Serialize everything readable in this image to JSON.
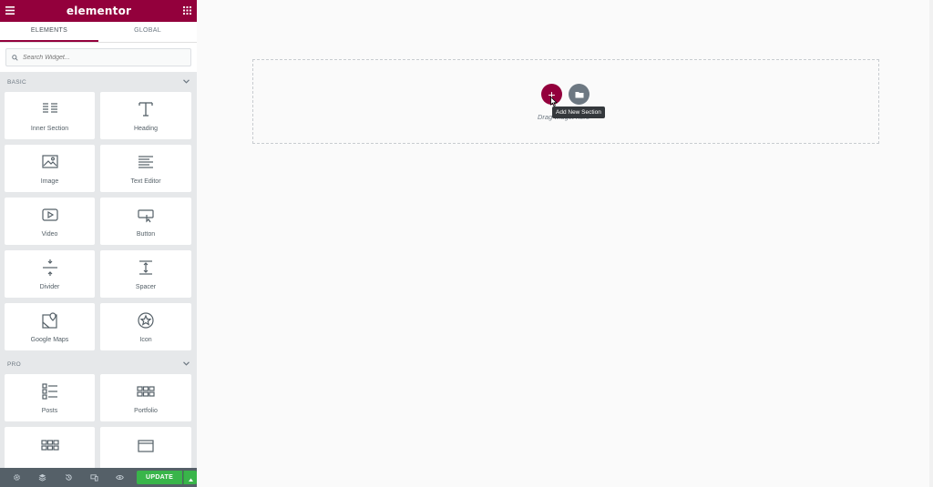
{
  "app": {
    "logo": "elementor"
  },
  "tabs": [
    {
      "label": "ELEMENTS",
      "active": true
    },
    {
      "label": "GLOBAL",
      "active": false
    }
  ],
  "search": {
    "placeholder": "Search Widget..."
  },
  "categories": {
    "basic": {
      "label": "BASIC",
      "widgets": [
        {
          "label": "Inner Section",
          "icon": "inner-section-icon"
        },
        {
          "label": "Heading",
          "icon": "heading-icon"
        },
        {
          "label": "Image",
          "icon": "image-icon"
        },
        {
          "label": "Text Editor",
          "icon": "text-editor-icon"
        },
        {
          "label": "Video",
          "icon": "video-icon"
        },
        {
          "label": "Button",
          "icon": "button-icon"
        },
        {
          "label": "Divider",
          "icon": "divider-icon"
        },
        {
          "label": "Spacer",
          "icon": "spacer-icon"
        },
        {
          "label": "Google Maps",
          "icon": "google-maps-icon"
        },
        {
          "label": "Icon",
          "icon": "star-icon"
        }
      ]
    },
    "pro": {
      "label": "PRO",
      "widgets": [
        {
          "label": "Posts",
          "icon": "posts-icon"
        },
        {
          "label": "Portfolio",
          "icon": "portfolio-icon"
        },
        {
          "label": "",
          "icon": "gallery-icon"
        },
        {
          "label": "",
          "icon": "slides-icon"
        }
      ]
    }
  },
  "footer": {
    "update_label": "UPDATE"
  },
  "canvas": {
    "drag_text": "Drag widget here",
    "tooltip": "Add New Section",
    "add_symbol": "+"
  },
  "colors": {
    "brand": "#93003c",
    "update": "#39b54a",
    "footer": "#556068"
  }
}
